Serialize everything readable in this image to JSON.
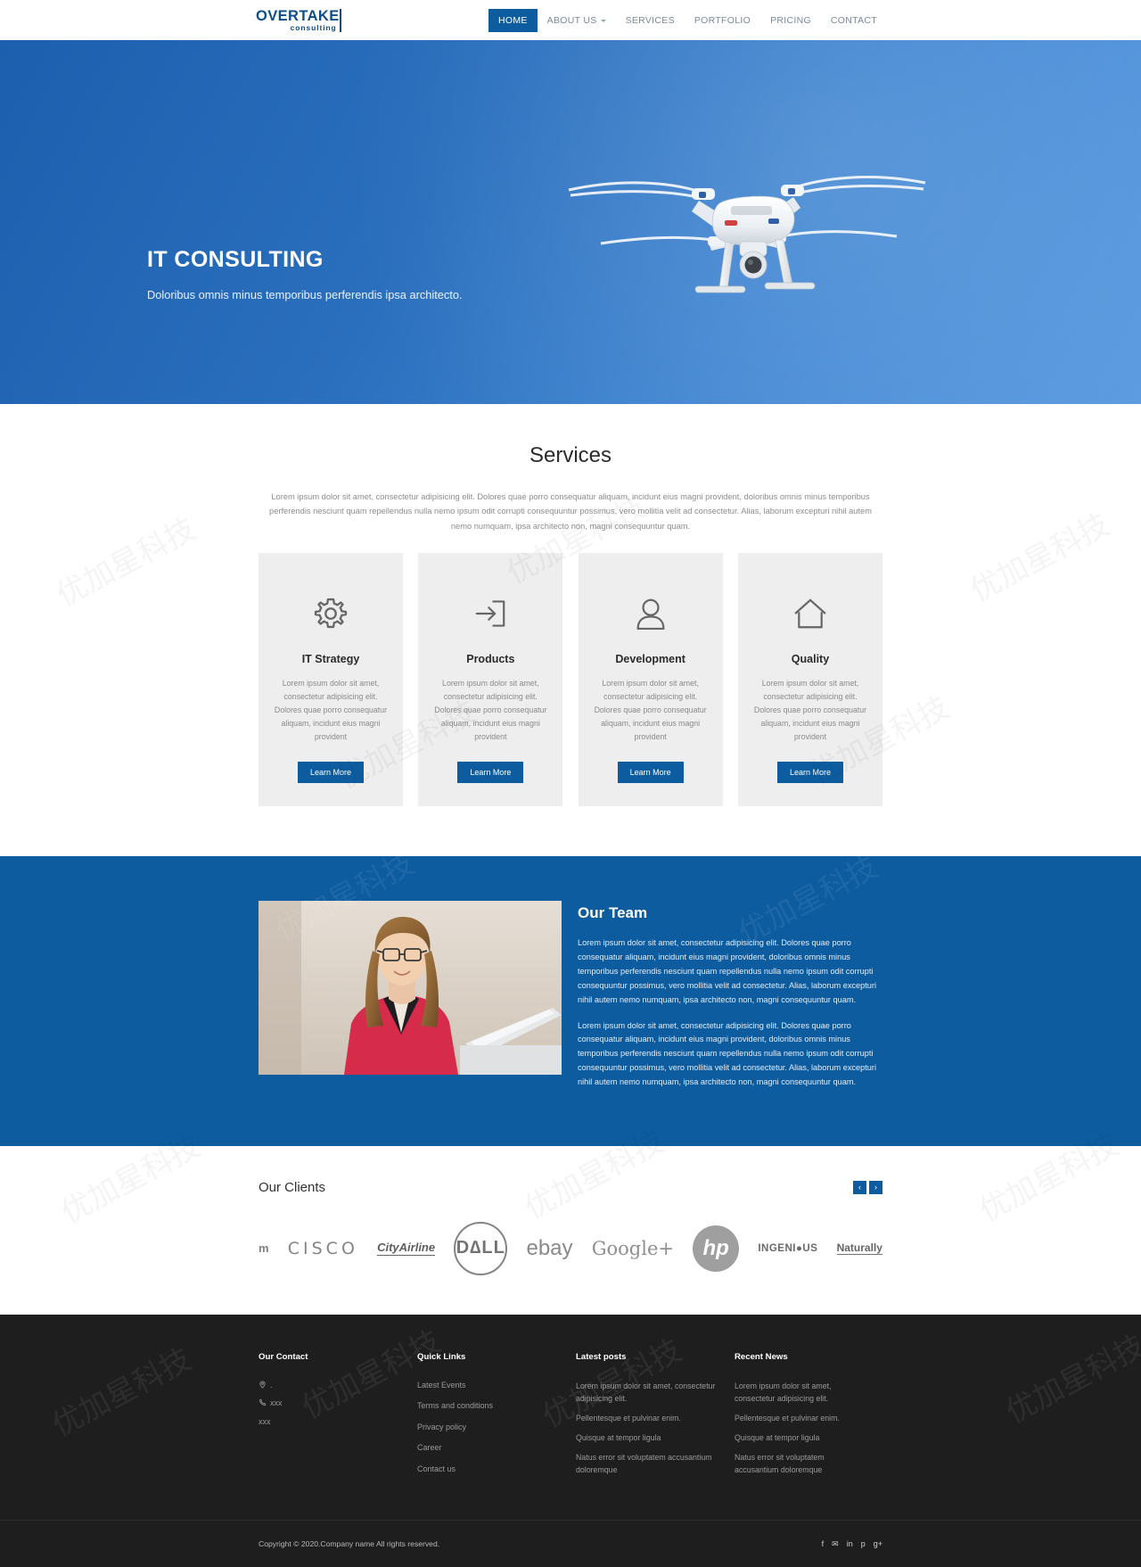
{
  "header": {
    "logo_main": "OVERTAKE",
    "logo_sub": "consulting",
    "nav": [
      {
        "label": "HOME",
        "active": true,
        "caret": false
      },
      {
        "label": "ABOUT US",
        "active": false,
        "caret": true
      },
      {
        "label": "SERVICES",
        "active": false,
        "caret": false
      },
      {
        "label": "PORTFOLIO",
        "active": false,
        "caret": false
      },
      {
        "label": "PRICING",
        "active": false,
        "caret": false
      },
      {
        "label": "CONTACT",
        "active": false,
        "caret": false
      }
    ]
  },
  "hero": {
    "title": "IT CONSULTING",
    "subtitle": "Doloribus omnis minus temporibus perferendis ipsa architecto.",
    "image": "drone-quadcopter-photo",
    "background_color": "#2a6fbd"
  },
  "services": {
    "title": "Services",
    "description": "Lorem ipsum dolor sit amet, consectetur adipisicing elit. Dolores quae porro consequatur aliquam, incidunt eius magni provident, doloribus omnis minus temporibus perferendis nesciunt quam repellendus nulla nemo ipsum odit corrupti consequuntur possimus, vero mollitia velit ad consectetur. Alias, laborum excepturi nihil autem nemo numquam, ipsa architecto non, magni consequuntur quam.",
    "card_text": "Lorem ipsum dolor sit amet, consectetur adipisicing elit. Dolores quae porro consequatur aliquam, incidunt eius magni provident",
    "button_label": "Learn More",
    "cards": [
      {
        "title": "IT Strategy",
        "icon": "gear-icon"
      },
      {
        "title": "Products",
        "icon": "login-arrow-icon"
      },
      {
        "title": "Development",
        "icon": "person-icon"
      },
      {
        "title": "Quality",
        "icon": "home-icon"
      }
    ]
  },
  "team": {
    "title": "Our Team",
    "image": "woman-with-laptop-photo",
    "paragraph1": "Lorem ipsum dolor sit amet, consectetur adipisicing elit. Dolores quae porro consequatur aliquam, incidunt eius magni provident, doloribus omnis minus temporibus perferendis nesciunt quam repellendus nulla nemo ipsum odit corrupti consequuntur possimus, vero mollitia velit ad consectetur. Alias, laborum excepturi nihil autem nemo numquam, ipsa architecto non, magni consequuntur quam.",
    "paragraph2": "Lorem ipsum dolor sit amet, consectetur adipisicing elit. Dolores quae porro consequatur aliquam, incidunt eius magni provident, doloribus omnis minus temporibus perferendis nesciunt quam repellendus nulla nemo ipsum odit corrupti consequuntur possimus, vero mollitia velit ad consectetur. Alias, laborum excepturi nihil autem nemo numquam, ipsa architecto non, magni consequuntur quam.",
    "background_color": "#0d5ca0"
  },
  "clients": {
    "title": "Our Clients",
    "prev_label": "‹",
    "next_label": "›",
    "logos": [
      {
        "name": "ibm-logo",
        "text": "m"
      },
      {
        "name": "cisco-logo",
        "text": "CISCO"
      },
      {
        "name": "cityairline-logo",
        "text": "CityAirline"
      },
      {
        "name": "dell-logo",
        "text": "D∆LL"
      },
      {
        "name": "ebay-logo",
        "text": "ebay"
      },
      {
        "name": "google-plus-logo",
        "text": "Google+"
      },
      {
        "name": "hp-logo",
        "text": "hp"
      },
      {
        "name": "ingenious-logo",
        "text": "INGENI●US"
      },
      {
        "name": "naturally-logo",
        "text": "Naturally"
      }
    ]
  },
  "footer": {
    "columns": [
      {
        "title": "Our Contact",
        "type": "contact",
        "items": [
          {
            "icon": "location-icon",
            "text": "."
          },
          {
            "icon": "phone-icon",
            "text": "xxx"
          },
          {
            "icon": "",
            "text": "xxx"
          }
        ]
      },
      {
        "title": "Quick Links",
        "type": "links",
        "items": [
          {
            "text": "Latest Events"
          },
          {
            "text": "Terms and conditions"
          },
          {
            "text": "Privacy policy"
          },
          {
            "text": "Career"
          },
          {
            "text": "Contact us"
          }
        ]
      },
      {
        "title": "Latest posts",
        "type": "news",
        "items": [
          {
            "text": "Lorem ipsum dolor sit amet, consectetur adipisicing elit."
          },
          {
            "text": "Pellentesque et pulvinar enim."
          },
          {
            "text": "Quisque at tempor ligula"
          },
          {
            "text": "Natus error sit voluptatem accusantium doloremque"
          }
        ]
      },
      {
        "title": "Recent News",
        "type": "news",
        "items": [
          {
            "text": "Lorem ipsum dolor sit amet, consectetur adipisicing elit."
          },
          {
            "text": "Pellentesque et pulvinar enim."
          },
          {
            "text": "Quisque at tempor ligula"
          },
          {
            "text": "Natus error sit voluptatem accusantium doloremque"
          }
        ]
      }
    ],
    "copyright": "Copyright © 2020.Company name All rights reserved.",
    "socials": [
      {
        "name": "facebook-icon",
        "glyph": "f"
      },
      {
        "name": "twitter-icon",
        "glyph": "✉"
      },
      {
        "name": "linkedin-icon",
        "glyph": "in"
      },
      {
        "name": "pinterest-icon",
        "glyph": "p"
      },
      {
        "name": "google-plus-icon",
        "glyph": "g+"
      }
    ]
  },
  "watermark": {
    "text": "优加星科技"
  }
}
